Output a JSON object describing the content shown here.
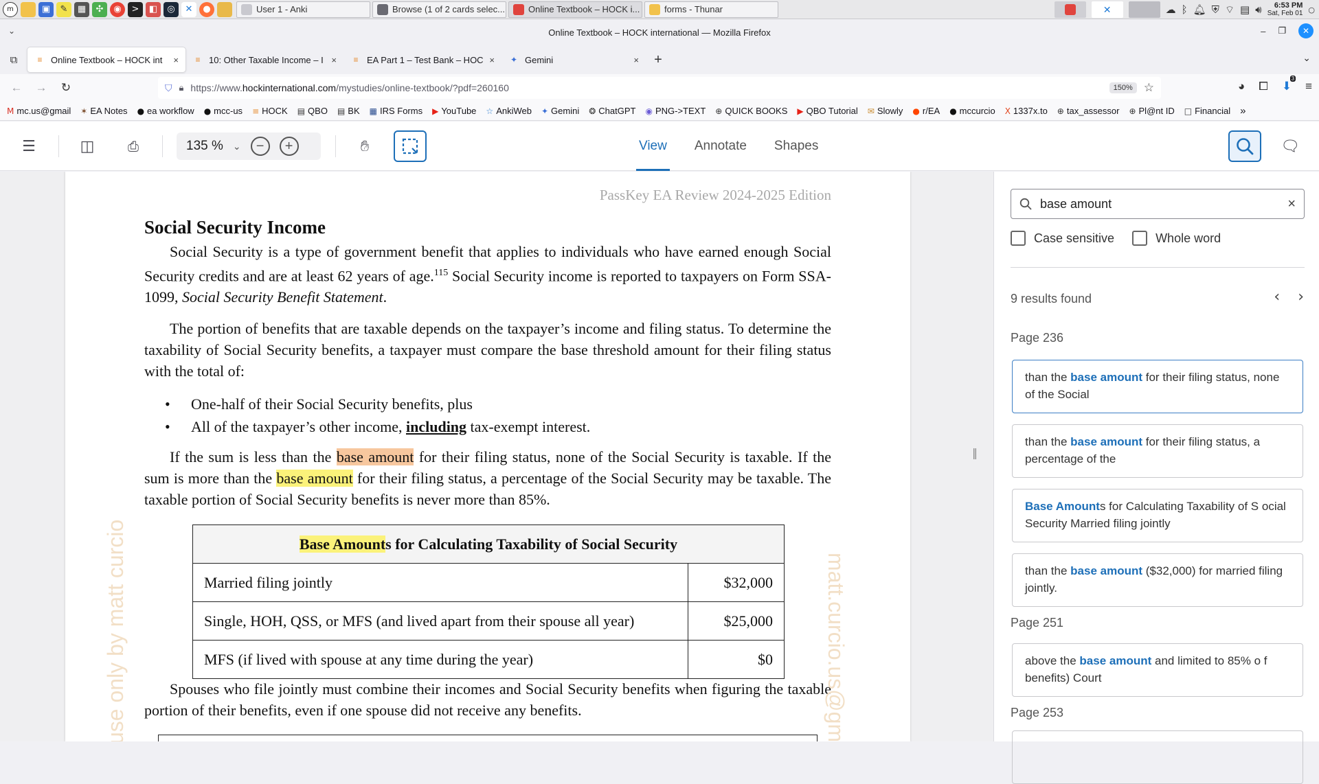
{
  "taskbar": {
    "windows": [
      {
        "label": "User 1 - Anki",
        "color": "#c9c9cf"
      },
      {
        "label": "Browse (1 of 2 cards selec...",
        "color": "#6a6a72"
      },
      {
        "label": "Online Textbook – HOCK i...",
        "color": "#e0443e"
      },
      {
        "label": "forms - Thunar",
        "color": "#f2c24b"
      }
    ],
    "clock_time": "6:53 PM",
    "clock_date": "Sat, Feb 01"
  },
  "browser": {
    "window_title": "Online Textbook – HOCK international — Mozilla Firefox",
    "tabs": [
      {
        "label": "Online Textbook – HOCK int",
        "close": "×",
        "icon": "hock"
      },
      {
        "label": "10: Other Taxable Income – I",
        "close": "×",
        "icon": "hock"
      },
      {
        "label": "EA Part 1 – Test Bank – HOC",
        "close": "×",
        "icon": "hock"
      },
      {
        "label": "Gemini",
        "close": "×",
        "icon": "gemini"
      }
    ],
    "url_prefix": "https://www.",
    "url_host": "hockinternational.com",
    "url_path": "/mystudies/online-textbook/?pdf=260160",
    "zoom": "150%",
    "extension_badge": "3",
    "bookmarks": [
      {
        "label": "mc.us@gmail",
        "icon": "M",
        "color": "#d93025"
      },
      {
        "label": "EA Notes",
        "icon": "✶",
        "color": "#7a4b2a"
      },
      {
        "label": "ea workflow",
        "icon": "●",
        "color": "#111"
      },
      {
        "label": "mcc-us",
        "icon": "●",
        "color": "#111"
      },
      {
        "label": "HOCK",
        "icon": "≡",
        "color": "#e58a2e"
      },
      {
        "label": "QBO",
        "icon": "▤",
        "color": "#333"
      },
      {
        "label": "BK",
        "icon": "▤",
        "color": "#333"
      },
      {
        "label": "IRS Forms",
        "icon": "▦",
        "color": "#2a4d8f"
      },
      {
        "label": "YouTube",
        "icon": "▶",
        "color": "#e62117"
      },
      {
        "label": "AnkiWeb",
        "icon": "☆",
        "color": "#2f7fd0"
      },
      {
        "label": "Gemini",
        "icon": "✦",
        "color": "#3b6fd6"
      },
      {
        "label": "ChatGPT",
        "icon": "❂",
        "color": "#333"
      },
      {
        "label": "PNG->TEXT",
        "icon": "◉",
        "color": "#6b5bd6"
      },
      {
        "label": "QUICK BOOKS",
        "icon": "⊕",
        "color": "#333"
      },
      {
        "label": "QBO Tutorial",
        "icon": "▶",
        "color": "#e62117"
      },
      {
        "label": "Slowly",
        "icon": "✉",
        "color": "#c98a2e"
      },
      {
        "label": "r/EA",
        "icon": "●",
        "color": "#ff4500"
      },
      {
        "label": "mccurcio",
        "icon": "●",
        "color": "#111"
      },
      {
        "label": "1337x.to",
        "icon": "X",
        "color": "#e2461f"
      },
      {
        "label": "tax_assessor",
        "icon": "⊕",
        "color": "#333"
      },
      {
        "label": "Pl@nt ID",
        "icon": "⊕",
        "color": "#333"
      },
      {
        "label": "Financial",
        "icon": "□",
        "color": "#333"
      }
    ],
    "bookmarks_overflow": "»"
  },
  "viewer": {
    "zoom_value": "135 %",
    "modes": [
      "View",
      "Annotate",
      "Shapes"
    ],
    "active_mode": "View"
  },
  "document": {
    "running_head": "PassKey EA Review 2024-2025 Edition",
    "section_title": "Social Security Income",
    "p1_a": "Social Security is a type of government benefit that applies to individuals who have earned enough Social Security credits and are at least 62 years of age.",
    "p1_sup": "115",
    "p1_b": " Social Security income is reported to taxpayers on Form SSA-1099, ",
    "p1_italic": "Social Security Benefit Statement",
    "p1_c": ".",
    "p2": "The portion of benefits that are taxable depends on the taxpayer’s income and filing status. To determine the taxability of Social Security benefits, a taxpayer must compare the base threshold amount for their filing status with the total of:",
    "bullet1": "One-half of their Social Security benefits, plus",
    "bullet2_a": "All of the taxpayer’s other income, ",
    "bullet2_u": "including",
    "bullet2_b": " tax-exempt interest.",
    "p3_a": "If the sum is less than the ",
    "p3_hl1": "base amount",
    "p3_b": " for their filing status, none of the Social Security is taxable. If the sum is more than the ",
    "p3_hl2": "base amount",
    "p3_c": " for their filing status, a percentage of the Social Security may be taxable. The taxable portion of Social Security benefits is never more than 85%.",
    "table_title_hl": "Base Amount",
    "table_title_rest": "s for Calculating Taxability of Social Security",
    "rows": [
      {
        "status": "Married filing jointly",
        "amount": "$32,000"
      },
      {
        "status": "Single, HOH, QSS, or MFS (and lived apart from their spouse all year)",
        "amount": "$25,000"
      },
      {
        "status": "MFS (if lived with spouse at any time during the year)",
        "amount": "$0"
      }
    ],
    "p4": "Spouses who file jointly must combine their incomes and Social Security benefits when figuring the taxable portion of their benefits, even if one spouse did not receive any benefits.",
    "watermark_left": "l use only by matt curcio",
    "watermark_right": "matt.curcio.us@gm"
  },
  "search": {
    "query": "base amount",
    "clear": "×",
    "case_sensitive_label": "Case sensitive",
    "whole_word_label": "Whole word",
    "results_count": "9 results found",
    "groups": [
      {
        "page": "Page 236",
        "results": [
          {
            "pre": "than the ",
            "match": "base amount",
            "post": " for their filing status, none of the Social"
          },
          {
            "pre": "than the ",
            "match": "base amount",
            "post": " for their filing status, a percentage of the"
          },
          {
            "pre": "",
            "match": "Base Amount",
            "post": "s for Calculating Taxability of S ocial Security Married filing jointly"
          },
          {
            "pre": "than the ",
            "match": "base amount",
            "post": " ($32,000) for married filing jointly."
          }
        ]
      },
      {
        "page": "Page 251",
        "results": [
          {
            "pre": "above the ",
            "match": "base amount",
            "post": " and limited to 85% o f benefits) Court"
          }
        ]
      },
      {
        "page": "Page 253",
        "results": []
      }
    ]
  }
}
